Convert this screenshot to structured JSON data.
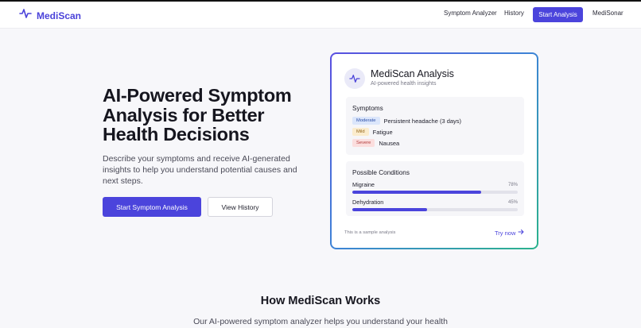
{
  "header": {
    "logo_text": "MediScan",
    "nav": {
      "symptom_analyzer": "Symptom Analyzer",
      "history": "History",
      "start_analysis": "Start Analysis",
      "medisonar": "MediSonar"
    }
  },
  "hero": {
    "title": "AI-Powered Symptom Analysis for Better Health Decisions",
    "description": "Describe your symptoms and receive AI-generated insights to help you understand potential causes and next steps.",
    "primary_button": "Start Symptom Analysis",
    "secondary_button": "View History"
  },
  "card": {
    "title": "MediScan Analysis",
    "subtitle": "AI-powered health insights",
    "symptoms_title": "Symptoms",
    "symptoms": [
      {
        "severity": "Moderate",
        "text": "Persistent headache (3 days)"
      },
      {
        "severity": "Mild",
        "text": "Fatigue"
      },
      {
        "severity": "Severe",
        "text": "Nausea"
      }
    ],
    "conditions_title": "Possible Conditions",
    "conditions": [
      {
        "name": "Migraine",
        "percent_label": "78%",
        "percent": 78
      },
      {
        "name": "Dehydration",
        "percent_label": "45%",
        "percent": 45
      }
    ],
    "footnote": "This is a sample analysis",
    "try_now": "Try now"
  },
  "how": {
    "title": "How MediScan Works",
    "subtitle": "Our AI-powered symptom analyzer helps you understand your health"
  },
  "colors": {
    "accent": "#4b44dc",
    "gradient_start": "#5a4fe0",
    "gradient_end": "#2bb38c"
  },
  "icons": {
    "logo": "pulse-icon",
    "card": "pulse-icon",
    "try_now": "arrow-right-icon"
  }
}
